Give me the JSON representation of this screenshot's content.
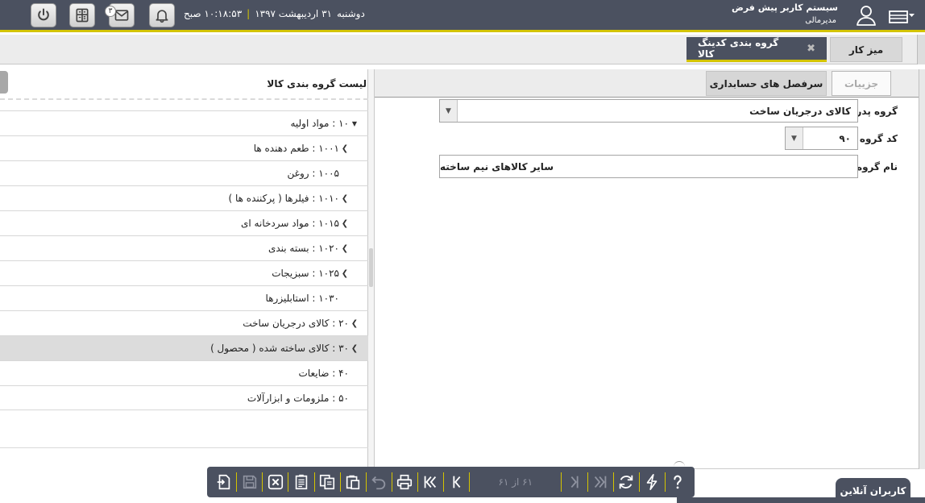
{
  "topbar": {
    "datetime": {
      "day": "دوشنبه",
      "date": "۳۱ اردیبهشت ۱۳۹۷",
      "time": "۱۰:۱۸:۵۳ صبح"
    },
    "user_name": "سیستم کاربر پیش فرض",
    "user_role": "مدیرمالی",
    "messages_badge": "۳",
    "buttons": [
      "power-icon",
      "calculator-icon",
      "mail-icon",
      "bell-icon"
    ]
  },
  "tabs": {
    "desk_label": "میز کار",
    "active_label": "گروه بندی کدینگ کالا"
  },
  "left_panel": {
    "title": "لیست گروه بندی کالا",
    "tree": [
      {
        "label": "۱۰ : مواد اولیه",
        "arrow": "expanded",
        "indent": 0
      },
      {
        "label": "۱۰۰۱ : طعم دهنده ها",
        "arrow": "collapsed",
        "indent": 1
      },
      {
        "label": "۱۰۰۵ : روغن",
        "arrow": "none",
        "indent": 1
      },
      {
        "label": "۱۰۱۰ : فیلرها ( پرکننده ها )",
        "arrow": "collapsed",
        "indent": 1
      },
      {
        "label": "۱۰۱۵ : مواد سردخانه ای",
        "arrow": "collapsed",
        "indent": 1
      },
      {
        "label": "۱۰۲۰ : بسته بندی",
        "arrow": "collapsed",
        "indent": 1
      },
      {
        "label": "۱۰۲۵ : سبزیجات",
        "arrow": "collapsed",
        "indent": 1
      },
      {
        "label": "۱۰۳۰ : استابلیزرها",
        "arrow": "none",
        "indent": 1
      },
      {
        "label": "۲۰ : کالای درجریان ساخت",
        "arrow": "collapsed",
        "indent": 0
      },
      {
        "label": "۳۰ : کالای ساخته شده ( محصول )",
        "arrow": "collapsed",
        "indent": 0,
        "selected": true
      },
      {
        "label": "۴۰ : ضایعات",
        "arrow": "none",
        "indent": 0
      },
      {
        "label": "۵۰ : ملزومات و ابزارآلات",
        "arrow": "none",
        "indent": 0
      }
    ]
  },
  "right_panel": {
    "sub_tabs": {
      "details": "جزییات",
      "accounting": "سرفصل های حسابداری"
    },
    "fields": {
      "parent_group_label": "گروه پدر",
      "parent_group_value": "کالای درجریان ساخت",
      "group_code_label": "کد گروه",
      "group_code_value": "۹۰",
      "group_name_label": "نام گروه",
      "group_name_value": "سایر کالاهای نیم ساخته"
    }
  },
  "bottombar": {
    "page_text": "۶۱ از ۶۱"
  },
  "online_users_label": "کاربران آنلاین",
  "colors": {
    "header_bg": "#4b5160",
    "accent": "#d4c400"
  }
}
